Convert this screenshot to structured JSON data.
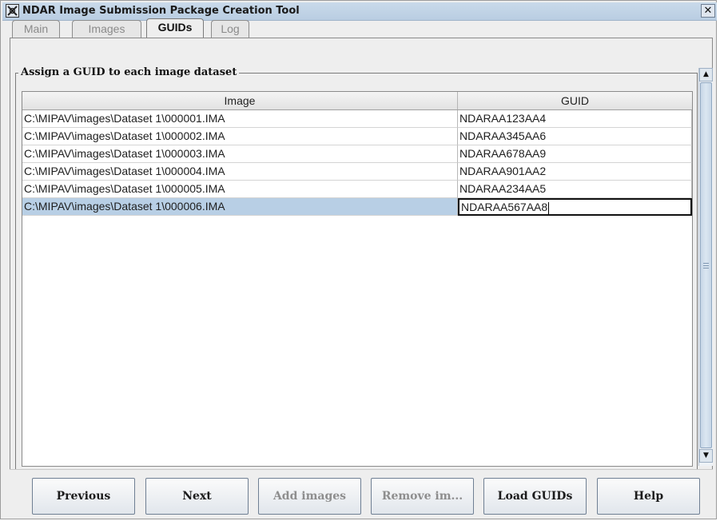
{
  "window": {
    "title": "NDAR Image Submission Package Creation Tool",
    "close_glyph": "✕",
    "icon": "ndar-app-icon"
  },
  "tabs": [
    {
      "label": "Main",
      "selected": false
    },
    {
      "label": "Images",
      "selected": false
    },
    {
      "label": "GUIDs",
      "selected": true
    },
    {
      "label": "Log",
      "selected": false
    }
  ],
  "panel": {
    "group_title": "Assign a GUID to each image dataset",
    "table": {
      "columns": [
        "Image",
        "GUID"
      ],
      "rows": [
        {
          "image": "C:\\MIPAV\\images\\Dataset 1\\000001.IMA",
          "guid": "NDARAA123AA4"
        },
        {
          "image": "C:\\MIPAV\\images\\Dataset 1\\000002.IMA",
          "guid": "NDARAA345AA6"
        },
        {
          "image": "C:\\MIPAV\\images\\Dataset 1\\000003.IMA",
          "guid": "NDARAA678AA9"
        },
        {
          "image": "C:\\MIPAV\\images\\Dataset 1\\000004.IMA",
          "guid": "NDARAA901AA2"
        },
        {
          "image": "C:\\MIPAV\\images\\Dataset 1\\000005.IMA",
          "guid": "NDARAA234AA5"
        },
        {
          "image": "C:\\MIPAV\\images\\Dataset 1\\000006.IMA",
          "guid": "NDARAA567AA8"
        }
      ],
      "selected_row": 5,
      "editing_cell": "guid"
    }
  },
  "buttons": {
    "previous": "Previous",
    "next": "Next",
    "add_images": "Add images",
    "remove_images": "Remove im...",
    "load_guids": "Load GUIDs",
    "help": "Help"
  },
  "colors": {
    "selection": "#b8cfe5",
    "titlebar": "#c9daea",
    "disabled_text": "#8e8e8e"
  }
}
